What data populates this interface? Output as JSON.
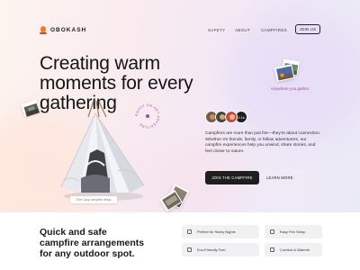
{
  "brand": {
    "name": "OBOKASH"
  },
  "nav": {
    "links": [
      "SAFETY",
      "ABOUT",
      "CAMPFIRES"
    ],
    "cta_label": "JOIN US"
  },
  "hero": {
    "headline": "Creating warm moments for every gathering",
    "tent_caption": "The Cozy campfire setup",
    "rotating_badge": "ENJOY ON ANY ADVENTURE",
    "anywhere_text": "Anywhere you gather",
    "avatar_count": "2.1k",
    "paragraph": "Campfires are more than just fire—they're about connection. Whether it's friends, family, or fellow adventurers, our campfire experiences help you unwind, share stories, and feel closer to nature.",
    "primary_cta": "JOIN THE CAMPFIRE",
    "secondary_cta": "LEARN MORE"
  },
  "section2": {
    "headline": "Quick and safe campfire arrangements for any outdoor spot.",
    "features": [
      {
        "label": "Perfect for Starry Nights",
        "icon": "moon-icon"
      },
      {
        "label": "Easy Fire Setup",
        "icon": "fire-icon"
      },
      {
        "label": "Eco-Friendly Fuel",
        "icon": "leaf-icon"
      },
      {
        "label": "Comfort & Warmth",
        "icon": "blanket-icon"
      }
    ]
  },
  "colors": {
    "accent_orange": "#f07a2a",
    "dark_button": "#1e1e1e",
    "badge_purple": "#a04ab0"
  }
}
